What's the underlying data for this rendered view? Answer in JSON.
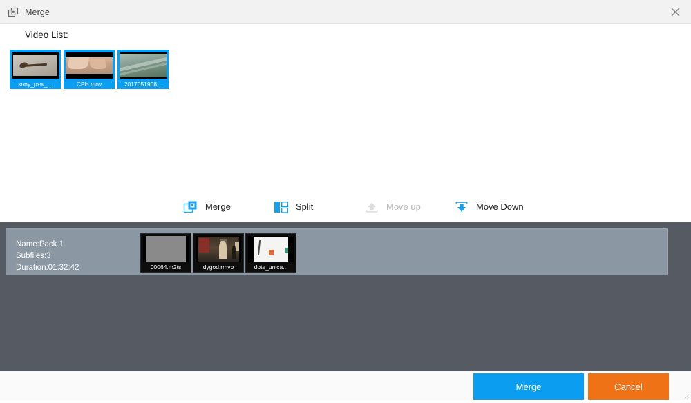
{
  "window": {
    "title": "Merge",
    "title_icon": "merge-squares-icon",
    "close_icon": "close-icon"
  },
  "video_list": {
    "label": "Video List:",
    "items": [
      {
        "name": "sony_pxw_...",
        "art": "art-sony"
      },
      {
        "name": "CPH.mov",
        "art": "art-cph"
      },
      {
        "name": "2017051908...",
        "art": "art-aerial"
      }
    ]
  },
  "toolbar": {
    "merge": {
      "label": "Merge",
      "icon": "merge-squares-icon",
      "enabled": true
    },
    "split": {
      "label": "Split",
      "icon": "split-panes-icon",
      "enabled": true
    },
    "move_up": {
      "label": "Move up",
      "icon": "arrow-up-icon",
      "enabled": false
    },
    "move_down": {
      "label": "Move Down",
      "icon": "arrow-down-icon",
      "enabled": true
    }
  },
  "pack": {
    "name_line": "Name:Pack 1",
    "subfiles_line": "Subfiles:3",
    "duration_line": "Duration:01:32:42",
    "meta_block": "Name:Pack 1\nSubfiles:3\nDuration:01:32:42",
    "items": [
      {
        "name": "00064.m2ts",
        "art": "art-gray"
      },
      {
        "name": "dygod.rmvb",
        "art": "art-street"
      },
      {
        "name": "dote_unica...",
        "art": "art-white"
      }
    ]
  },
  "footer": {
    "merge_label": "Merge",
    "cancel_label": "Cancel"
  },
  "colors": {
    "accent_blue": "#0b9ef0",
    "accent_orange": "#ef7216",
    "panel_dark": "#565a63",
    "pack_row": "#8b97a3",
    "titlebar": "#f2f2f2"
  }
}
